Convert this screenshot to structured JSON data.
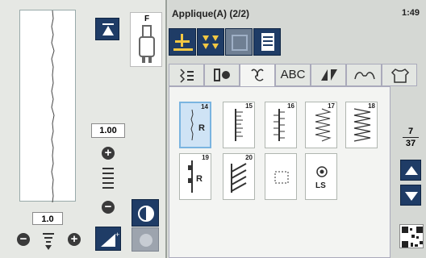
{
  "header": {
    "title": "Applique(A) (2/2)",
    "time": "1:49"
  },
  "left": {
    "foot_label": "F",
    "stitch_length": "1.00",
    "stitch_width": "1.0"
  },
  "tabs": [
    {
      "name": "utility-tab"
    },
    {
      "name": "buttonhole-tab"
    },
    {
      "name": "decorative-tab"
    },
    {
      "name": "alphabet-tab",
      "label": "ABC"
    },
    {
      "name": "quilting-tab"
    },
    {
      "name": "heirloom-tab"
    },
    {
      "name": "garment-tab"
    }
  ],
  "stitches": [
    {
      "num": "14",
      "label": "R",
      "selected": true
    },
    {
      "num": "15"
    },
    {
      "num": "16"
    },
    {
      "num": "17"
    },
    {
      "num": "18"
    },
    {
      "num": "19",
      "label": "R"
    },
    {
      "num": "20"
    },
    {
      "num": ""
    },
    {
      "num": "",
      "label": "LS"
    }
  ],
  "pagination": {
    "current": "7",
    "total": "37"
  },
  "colors": {
    "accent": "#1f3c66",
    "selected": "#cfe3f5"
  }
}
